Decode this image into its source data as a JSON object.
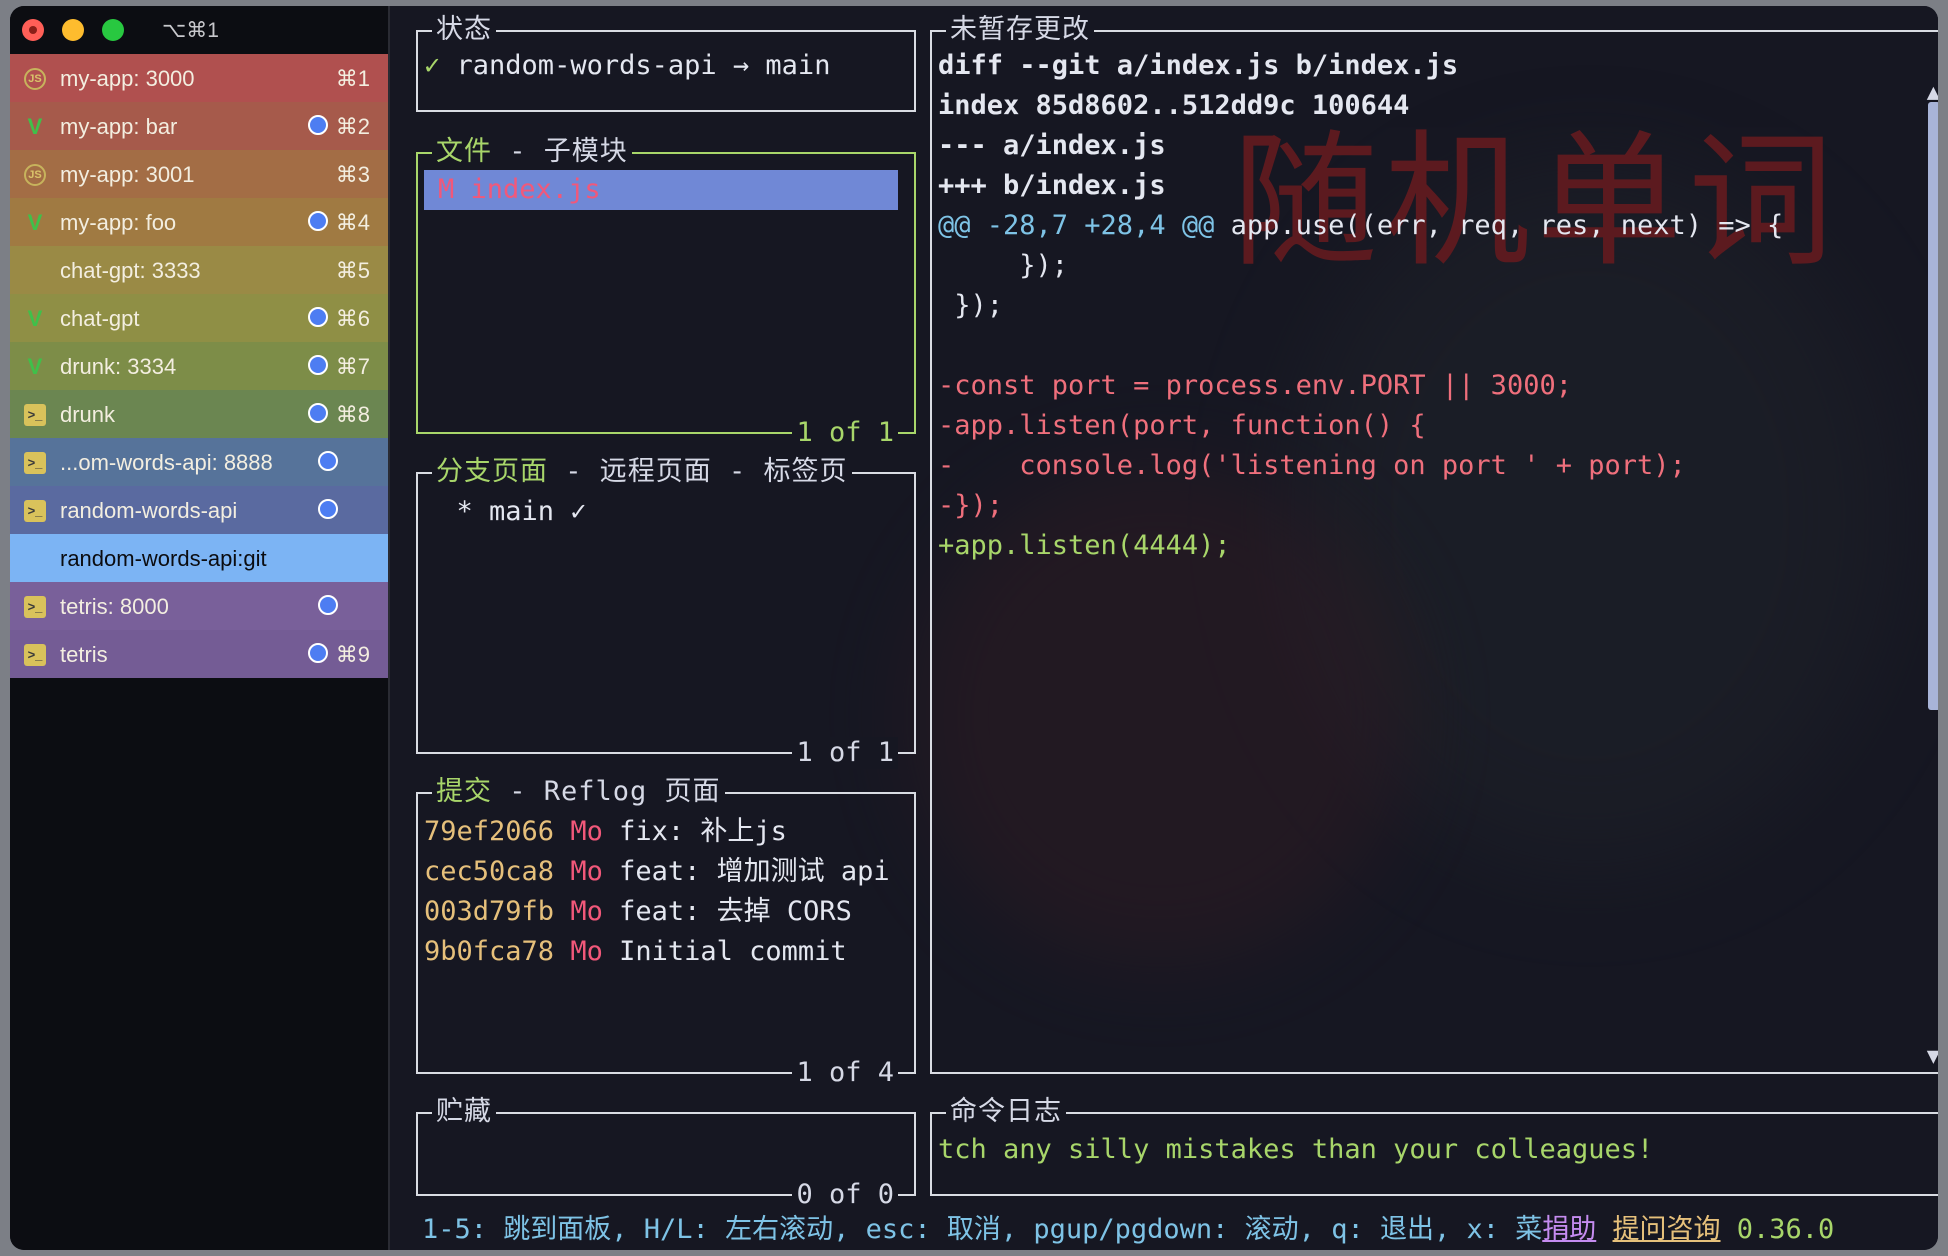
{
  "window": {
    "title_shortcut": "⌥⌘1"
  },
  "sidebar": {
    "tabs": [
      {
        "label": "my-app: 3000",
        "shortcut": "⌘1",
        "icon": "node-icon",
        "dot": false,
        "bg": "#b0504f"
      },
      {
        "label": "my-app: bar",
        "shortcut": "⌘2",
        "icon": "vim-icon",
        "dot": true,
        "bg": "#a65a4b"
      },
      {
        "label": "my-app: 3001",
        "shortcut": "⌘3",
        "icon": "node-icon",
        "dot": false,
        "bg": "#a36d45"
      },
      {
        "label": "my-app: foo",
        "shortcut": "⌘4",
        "icon": "vim-icon",
        "dot": true,
        "bg": "#a07a42"
      },
      {
        "label": "chat-gpt: 3333",
        "shortcut": "⌘5",
        "icon": "none",
        "dot": false,
        "bg": "#9a8a45"
      },
      {
        "label": "chat-gpt",
        "shortcut": "⌘6",
        "icon": "vim-icon",
        "dot": true,
        "bg": "#8f8f45"
      },
      {
        "label": "drunk: 3334",
        "shortcut": "⌘7",
        "icon": "vim-icon",
        "dot": true,
        "bg": "#7d8d48"
      },
      {
        "label": "drunk",
        "shortcut": "⌘8",
        "icon": "terminal-icon",
        "dot": true,
        "bg": "#6b8651"
      },
      {
        "label": "...om-words-api: 8888",
        "shortcut": "",
        "icon": "terminal-icon",
        "dot": true,
        "bg": "#56739a"
      },
      {
        "label": "random-words-api",
        "shortcut": "",
        "icon": "terminal-icon",
        "dot": true,
        "bg": "#5a6aa0"
      },
      {
        "label": "random-words-api:git",
        "shortcut": "",
        "icon": "none",
        "dot": false,
        "bg": "#7cb4f4",
        "active": true
      },
      {
        "label": "tetris: 8000",
        "shortcut": "",
        "icon": "terminal-icon",
        "dot": true,
        "bg": "#79609a"
      },
      {
        "label": "tetris",
        "shortcut": "⌘9",
        "icon": "terminal-icon",
        "dot": true,
        "bg": "#745c95"
      }
    ]
  },
  "watermark": "随机单词",
  "panels": {
    "status": {
      "title": "状态",
      "check": "✓",
      "repo": "random-words-api",
      "arrow": "→",
      "branch": "main"
    },
    "files": {
      "title_active": "文件",
      "title_rest": " - 子模块",
      "row_status": "M",
      "row_file": "index.js",
      "footer": "1 of 1"
    },
    "branches": {
      "title_active": "分支页面",
      "title_rest": " - 远程页面 - 标签页",
      "row": "  * main ✓",
      "footer": "1 of 1"
    },
    "commits": {
      "title_active": "提交",
      "title_rest": " - Reflog 页面",
      "rows": [
        {
          "hash": "79ef2066",
          "author": "Mo",
          "msg": "fix: 补上js"
        },
        {
          "hash": "cec50ca8",
          "author": "Mo",
          "msg": "feat: 增加测试 api"
        },
        {
          "hash": "003d79fb",
          "author": "Mo",
          "msg": "feat: 去掉 CORS"
        },
        {
          "hash": "9b0fca78",
          "author": "Mo",
          "msg": "Initial commit"
        }
      ],
      "footer": "1 of 4"
    },
    "stash": {
      "title": "贮藏",
      "footer": "0 of 0"
    },
    "diff": {
      "title": "未暂存更改",
      "header": [
        "diff --git a/index.js b/index.js",
        "index 85d8602..512dd9c 100644",
        "--- a/index.js",
        "+++ b/index.js"
      ],
      "hunk": "@@ -28,7 +28,4 @@",
      "hunk_ctx": " app.use((err, req, res, next) => {",
      "context": [
        "     });",
        " });",
        " "
      ],
      "removed": [
        "-const port = process.env.PORT || 3000;",
        "-app.listen(port, function() {",
        "-    console.log('listening on port ' + port);",
        "-});"
      ],
      "added": [
        "+app.listen(4444);"
      ]
    },
    "log": {
      "title": "命令日志",
      "text": "tch any silly mistakes than your colleagues!"
    }
  },
  "statusbar": {
    "keys": "1-5: 跳到面板, H/L: 左右滚动, esc: 取消, pgup/pgdown: 滚动, q: 退出, x: 菜",
    "donate": "捐助",
    "ask": "提问咨询",
    "version": "0.36.0"
  },
  "colors": {
    "border": "#d9dce3",
    "active_border": "#a8d66a",
    "hash": "#e6c07b",
    "author": "#f1587a",
    "removed": "#ef6f7c",
    "added": "#a8d66a",
    "hunk": "#7ec3e6"
  }
}
